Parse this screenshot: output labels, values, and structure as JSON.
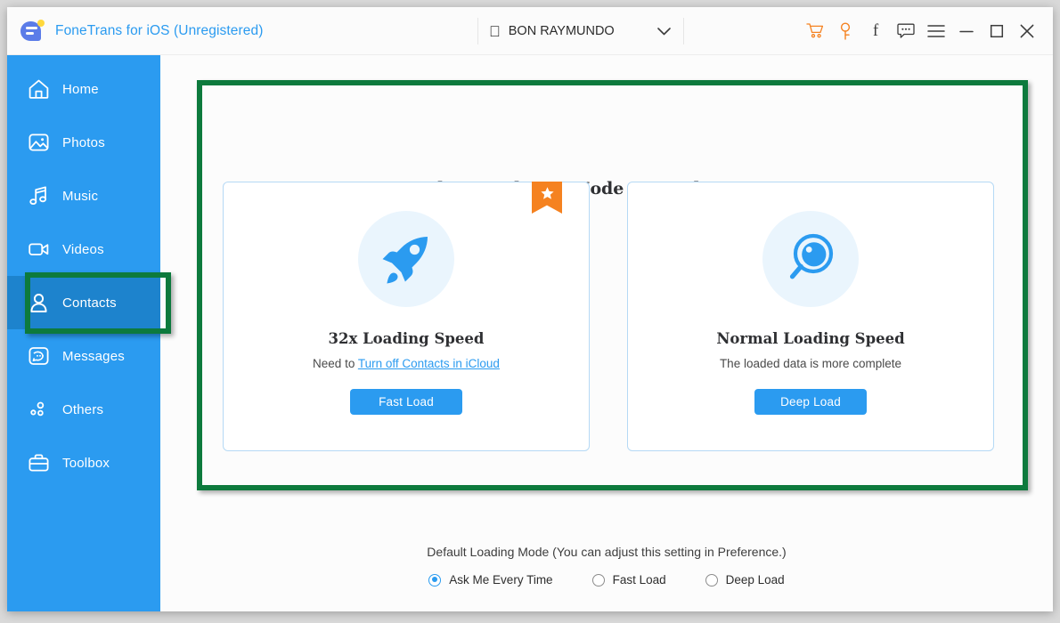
{
  "titlebar": {
    "app_title": "FoneTrans for iOS (Unregistered)",
    "logo_icon": "fonetrans-logo-icon",
    "device": {
      "apple_icon": "apple-logo-icon",
      "name": "BON RAYMUNDO",
      "chevron_icon": "chevron-down-icon"
    },
    "icons": [
      {
        "name": "cart-icon",
        "label": "Buy",
        "color": "#f58220"
      },
      {
        "name": "key-icon",
        "label": "Register",
        "color": "#f58220"
      },
      {
        "name": "facebook-icon",
        "label": "Facebook",
        "color": "#3c3c3c"
      },
      {
        "name": "feedback-icon",
        "label": "Feedback",
        "color": "#3c3c3c"
      },
      {
        "name": "menu-icon",
        "label": "Menu",
        "color": "#3c3c3c"
      },
      {
        "name": "minimize-icon",
        "label": "Minimize",
        "color": "#3c3c3c"
      },
      {
        "name": "maximize-icon",
        "label": "Maximize",
        "color": "#3c3c3c"
      },
      {
        "name": "close-icon",
        "label": "Close",
        "color": "#3c3c3c"
      }
    ]
  },
  "sidebar": {
    "background_color": "#2b9bf0",
    "active_color": "#1d83cd",
    "items": [
      {
        "label": "Home",
        "icon": "home-icon",
        "active": false
      },
      {
        "label": "Photos",
        "icon": "photos-icon",
        "active": false
      },
      {
        "label": "Music",
        "icon": "music-icon",
        "active": false
      },
      {
        "label": "Videos",
        "icon": "videos-icon",
        "active": false
      },
      {
        "label": "Contacts",
        "icon": "contacts-icon",
        "active": true
      },
      {
        "label": "Messages",
        "icon": "messages-icon",
        "active": false
      },
      {
        "label": "Others",
        "icon": "others-icon",
        "active": false
      },
      {
        "label": "Toolbox",
        "icon": "toolbox-icon",
        "active": false
      }
    ]
  },
  "main": {
    "headline": "Please Select a Mode to Load Contacts",
    "cards": [
      {
        "badge_icon": "star-ribbon-icon",
        "has_badge": true,
        "icon": "rocket-icon",
        "title": "32x Loading Speed",
        "sub_prefix": "Need to ",
        "sub_link": "Turn off Contacts in iCloud",
        "button_label": "Fast Load",
        "accent_color": "#2b9bf0"
      },
      {
        "has_badge": false,
        "icon": "magnifier-icon",
        "title": "Normal Loading Speed",
        "sub_prefix": "The loaded data is more complete",
        "sub_link": "",
        "button_label": "Deep Load",
        "accent_color": "#2b9bf0"
      }
    ],
    "footer": {
      "label": "Default Loading Mode (You can adjust this setting in Preference.)",
      "options": [
        {
          "label": "Ask Me Every Time",
          "checked": true
        },
        {
          "label": "Fast Load",
          "checked": false
        },
        {
          "label": "Deep Load",
          "checked": false
        }
      ]
    }
  },
  "annotations": {
    "color": "#0d7a3d",
    "boxes": [
      {
        "name": "contacts-highlight"
      },
      {
        "name": "mode-panel-highlight"
      }
    ]
  }
}
